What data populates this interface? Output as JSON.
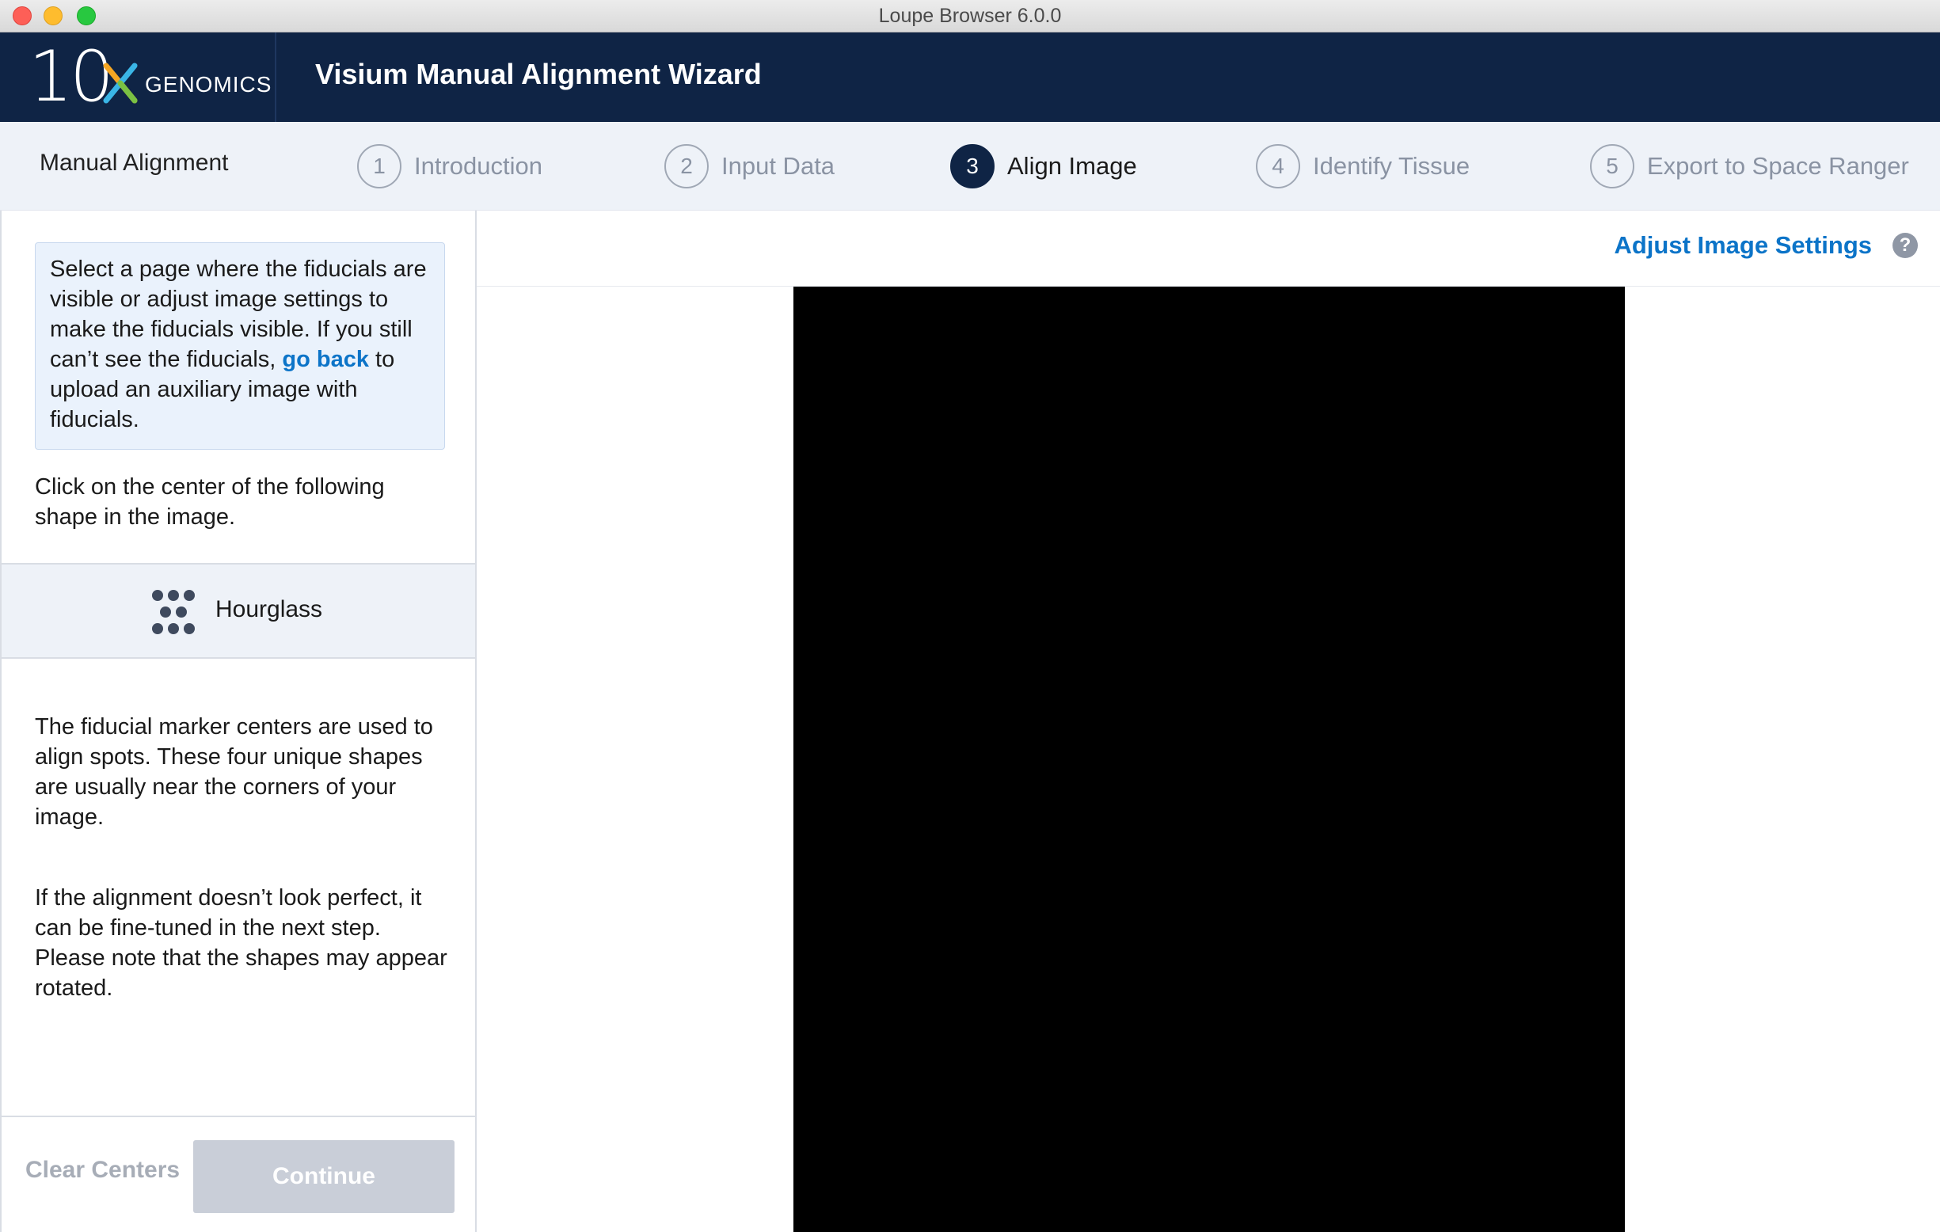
{
  "window": {
    "title": "Loupe Browser 6.0.0"
  },
  "header": {
    "logo_number": "10",
    "logo_text": "GENOMICS",
    "wizard_title": "Visium Manual Alignment Wizard"
  },
  "steps_bar": {
    "section_label": "Manual Alignment",
    "steps": [
      {
        "num": "1",
        "label": "Introduction",
        "active": false
      },
      {
        "num": "2",
        "label": "Input Data",
        "active": false
      },
      {
        "num": "3",
        "label": "Align Image",
        "active": true
      },
      {
        "num": "4",
        "label": "Identify Tissue",
        "active": false
      },
      {
        "num": "5",
        "label": "Export to Space Ranger",
        "active": false
      }
    ]
  },
  "sidebar": {
    "info_text_before": "Select a page where the fiducials are visible or adjust image settings to make the fiducials visible. If you still can’t see the fiducials, ",
    "info_link": "go back",
    "info_text_after": " to upload an auxiliary image with fiducials.",
    "instruction": "Click on the center of the following shape in the image.",
    "shape_name": "Hourglass",
    "shape_icon": "hourglass-dots-icon",
    "description_1": "The fiducial marker centers are used to align spots. These four unique shapes are usually near the corners of your image.",
    "description_2": "If the alignment doesn’t look perfect, it can be fine-tuned in the next step. Please note that the shapes may appear rotated.",
    "clear_button": "Clear Centers",
    "continue_button": "Continue"
  },
  "main": {
    "adjust_link": "Adjust Image Settings",
    "help_icon": "?"
  },
  "colors": {
    "header_bg": "#0f2445",
    "accent_link": "#0c74c8",
    "steps_bg": "#eef2f8",
    "info_box_bg": "#eaf2fc",
    "disabled_button": "#c9ced8"
  }
}
